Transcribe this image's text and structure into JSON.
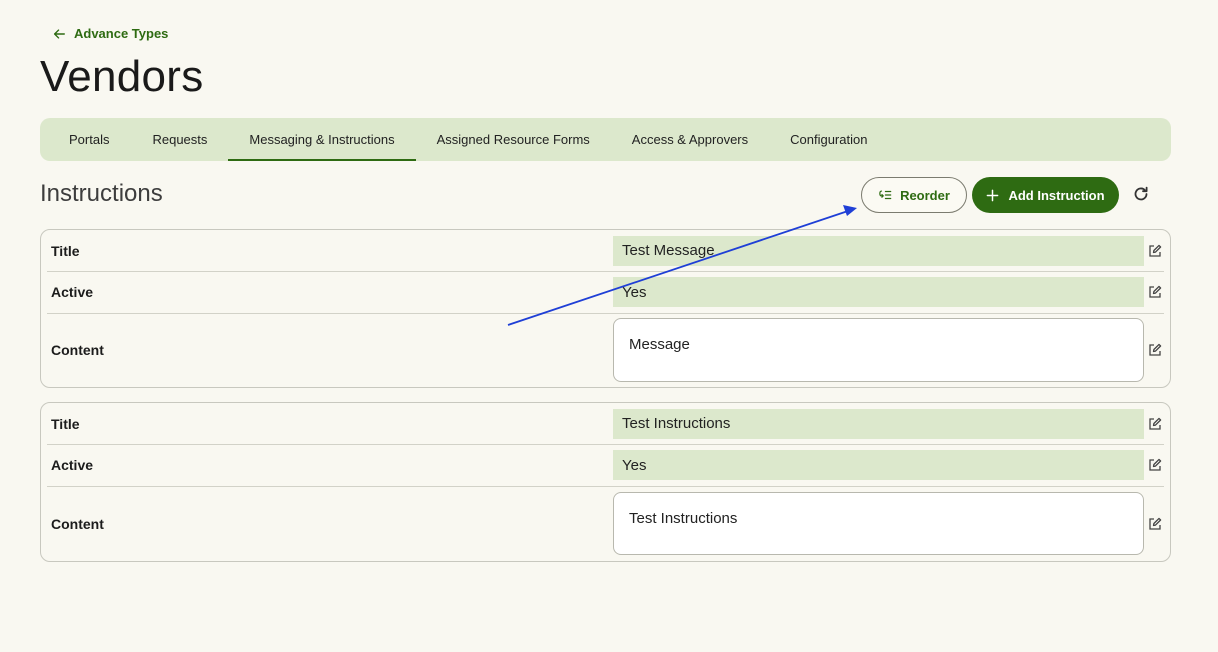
{
  "back": {
    "label": "Advance Types",
    "icon": "arrow-left-icon"
  },
  "page": {
    "title": "Vendors"
  },
  "tabs": [
    {
      "label": "Portals",
      "active": false
    },
    {
      "label": "Requests",
      "active": false
    },
    {
      "label": "Messaging & Instructions",
      "active": true
    },
    {
      "label": "Assigned Resource Forms",
      "active": false
    },
    {
      "label": "Access & Approvers",
      "active": false
    },
    {
      "label": "Configuration",
      "active": false
    }
  ],
  "section": {
    "title": "Instructions"
  },
  "actions": {
    "reorder_label": "Reorder",
    "add_label": "Add Instruction",
    "refresh_icon": "refresh-icon"
  },
  "instructions": [
    {
      "title_label": "Title",
      "title_value": "Test Message",
      "active_label": "Active",
      "active_value": "Yes",
      "content_label": "Content",
      "content_value": "Message"
    },
    {
      "title_label": "Title",
      "title_value": "Test Instructions",
      "active_label": "Active",
      "active_value": "Yes",
      "content_label": "Content",
      "content_value": "Test Instructions"
    }
  ],
  "colors": {
    "accent": "#2e6b12",
    "tab_bar": "#dce8cc",
    "background": "#f9f8f1",
    "annotation_arrow": "#1f3fd6"
  }
}
